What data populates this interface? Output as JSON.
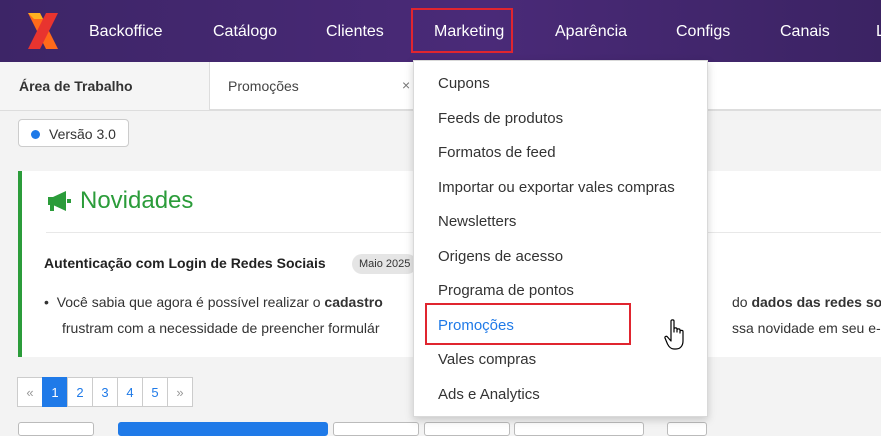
{
  "topbar": {
    "logo": "x-logo-icon",
    "nav": [
      {
        "label": "Backoffice"
      },
      {
        "label": "Catálogo"
      },
      {
        "label": "Clientes"
      },
      {
        "label": "Marketing"
      },
      {
        "label": "Aparência"
      },
      {
        "label": "Configs"
      },
      {
        "label": "Canais"
      },
      {
        "label": "L"
      }
    ]
  },
  "tabs": {
    "active": "Área de Trabalho",
    "second": "Promoções",
    "close_glyph": "×"
  },
  "version": {
    "label": "Versão 3.0",
    "color": "#1f7ae8"
  },
  "news": {
    "title": "Novidades",
    "icon": "megaphone-icon",
    "heading": "Autenticação com Login de Redes Sociais",
    "badge": "Maio 2025",
    "line1_a": "Você sabia que agora é possível realizar o ",
    "line1_b": "cadastro",
    "line1_right_a": "do ",
    "line1_right_b": "dados das redes socia",
    "line2_left": "frustram com a necessidade de preencher formulár",
    "line2_right": "ssa novidade em seu e-co",
    "accent": "#2b9c3a"
  },
  "pagination": {
    "prev": "«",
    "pages": [
      "1",
      "2",
      "3",
      "4",
      "5"
    ],
    "active": "1",
    "next": "»"
  },
  "dropdown": {
    "items": [
      "Cupons",
      "Feeds de produtos",
      "Formatos de feed",
      "Importar ou exportar vales compras",
      "Newsletters",
      "Origens de acesso",
      "Programa de pontos",
      "Promoções",
      "Vales compras",
      "Ads e Analytics"
    ],
    "selected": "Promoções",
    "highlight_color": "#e0252f"
  }
}
